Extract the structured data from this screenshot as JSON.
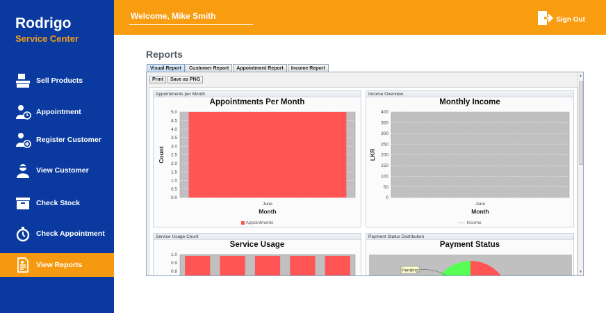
{
  "brand": {
    "name": "Rodrigo",
    "subtitle": "Service Center"
  },
  "sidebar": {
    "items": [
      {
        "label": "Sell Products",
        "icon": "box-icon",
        "active": false
      },
      {
        "label": "Appointment",
        "icon": "user-clock-icon",
        "active": false
      },
      {
        "label": "Register Customer",
        "icon": "user-add-icon",
        "active": false
      },
      {
        "label": "View Customer",
        "icon": "user-icon",
        "active": false
      },
      {
        "label": "Check Stock",
        "icon": "inventory-icon",
        "active": false
      },
      {
        "label": "Check Appointment",
        "icon": "stopwatch-icon",
        "active": false
      },
      {
        "label": "View Reports",
        "icon": "report-icon",
        "active": true
      }
    ]
  },
  "header": {
    "welcome": "Welcome, Mike Smith",
    "signout_label": "Sign Out"
  },
  "main": {
    "title": "Reports",
    "tabs": [
      "Visual Report",
      "Customer Report",
      "Appointment Report",
      "Income Report"
    ],
    "toolbar": {
      "print_label": "Print",
      "save_label": "Save as PNG"
    }
  },
  "colors": {
    "sidebar_bg": "#0a3aa0",
    "accent": "#f59a10",
    "bar": "#ff5555",
    "plot_bg": "#c0c0c0"
  },
  "chart_data": [
    {
      "panel_label": "Appointments per Month",
      "type": "bar",
      "title": "Appointments Per Month",
      "xlabel": "Month",
      "ylabel": "Count",
      "categories": [
        "June"
      ],
      "series": [
        {
          "name": "Appointments",
          "values": [
            5
          ]
        }
      ],
      "ylim": [
        0,
        5
      ],
      "yticks": [
        "0.0",
        "0.5",
        "1.0",
        "1.5",
        "2.0",
        "2.5",
        "3.0",
        "3.5",
        "4.0",
        "4.5",
        "5.0"
      ],
      "grid": true
    },
    {
      "panel_label": "Income Overview",
      "type": "line",
      "title": "Monthly Income",
      "xlabel": "Month",
      "ylabel": "LKR",
      "categories": [
        "June"
      ],
      "series": [
        {
          "name": "Income",
          "values": []
        }
      ],
      "ylim": [
        0,
        400
      ],
      "yticks": [
        "0",
        "50",
        "100",
        "150",
        "200",
        "250",
        "300",
        "350",
        "400"
      ],
      "grid": true
    },
    {
      "panel_label": "Service Usage Count",
      "type": "bar",
      "title": "Service Usage",
      "categories": [
        "",
        "",
        "",
        "",
        ""
      ],
      "series": [
        {
          "name": "",
          "values": [
            1,
            1,
            1,
            1,
            1
          ]
        }
      ],
      "ylim": [
        0,
        1.0
      ],
      "yticks": [
        "0.8",
        "0.9",
        "1.0"
      ]
    },
    {
      "panel_label": "Payment Status Distribution",
      "type": "pie",
      "title": "Payment Status",
      "labels": [
        "Pending"
      ]
    }
  ]
}
